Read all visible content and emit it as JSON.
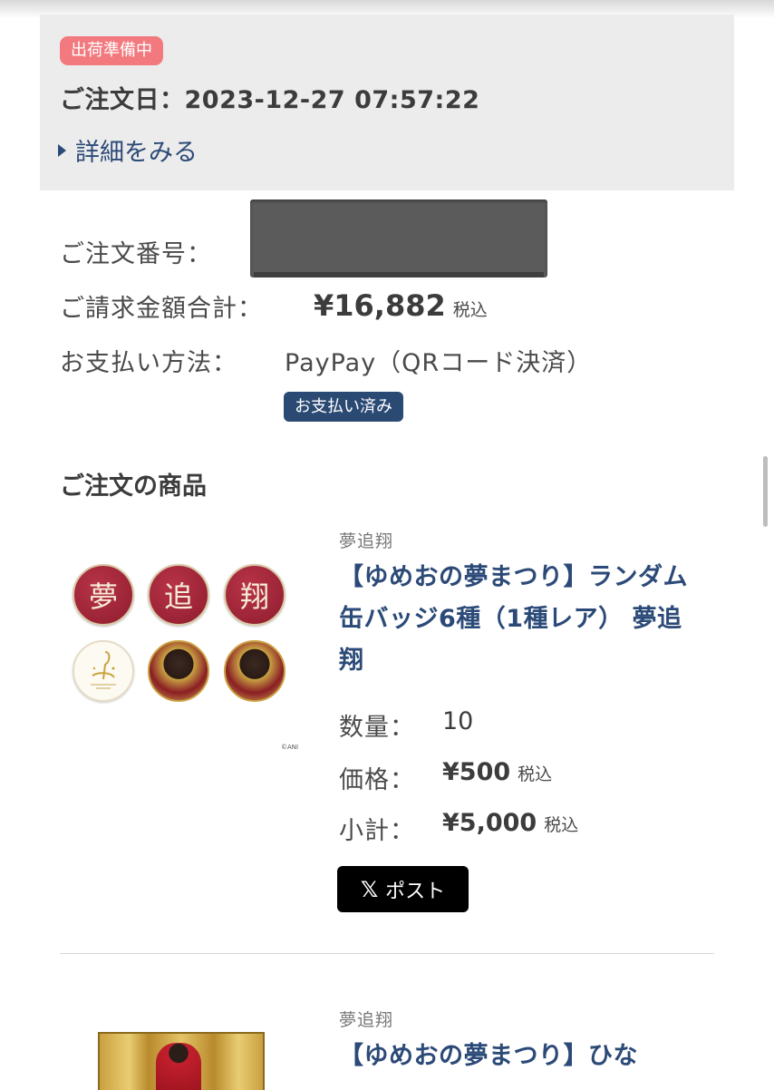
{
  "order": {
    "status_badge": "出荷準備中",
    "date_label": "ご注文日：",
    "date_value": "2023-12-27 07:57:22",
    "details_link": "詳細をみる",
    "number_label": "ご注文番号：",
    "total_label": "ご請求金額合計：",
    "total_value": "¥16,882",
    "tax_note": "税込",
    "payment_label": "お支払い方法：",
    "payment_value": "PayPay（QRコード決済）",
    "paid_badge": "お支払い済み"
  },
  "section_title": "ご注文の商品",
  "products": [
    {
      "brand": "夢追翔",
      "title": "【ゆめおの夢まつり】ランダム缶バッジ6種（1種レア） 夢追翔",
      "badge_kanji": [
        "夢",
        "追",
        "翔"
      ],
      "copyright": "©ANI",
      "quantity_label": "数量：",
      "quantity": "10",
      "price_label": "価格：",
      "price": "¥500",
      "subtotal_label": "小計：",
      "subtotal": "¥5,000",
      "tax_note": "税込",
      "post_button": "ポスト",
      "post_icon": "𝕏"
    },
    {
      "brand": "夢追翔",
      "title": "【ゆめおの夢まつり】ひな"
    }
  ],
  "colors": {
    "status_badge": "#f27a7f",
    "paid_badge": "#2b4a73",
    "link": "#2c4a78",
    "panel": "#ececec"
  }
}
